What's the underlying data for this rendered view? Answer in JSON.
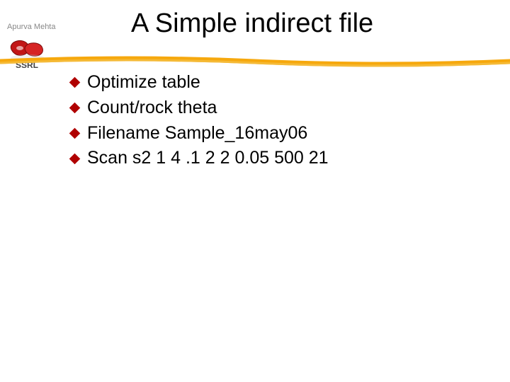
{
  "author": "Apurva Mehta",
  "org_label": "SSRL",
  "title": "A Simple indirect file",
  "bullets": [
    "Optimize table",
    "Count/rock theta",
    "Filename Sample_16may06",
    "Scan s2 1 4 .1 2 2 0.05 500 21"
  ]
}
